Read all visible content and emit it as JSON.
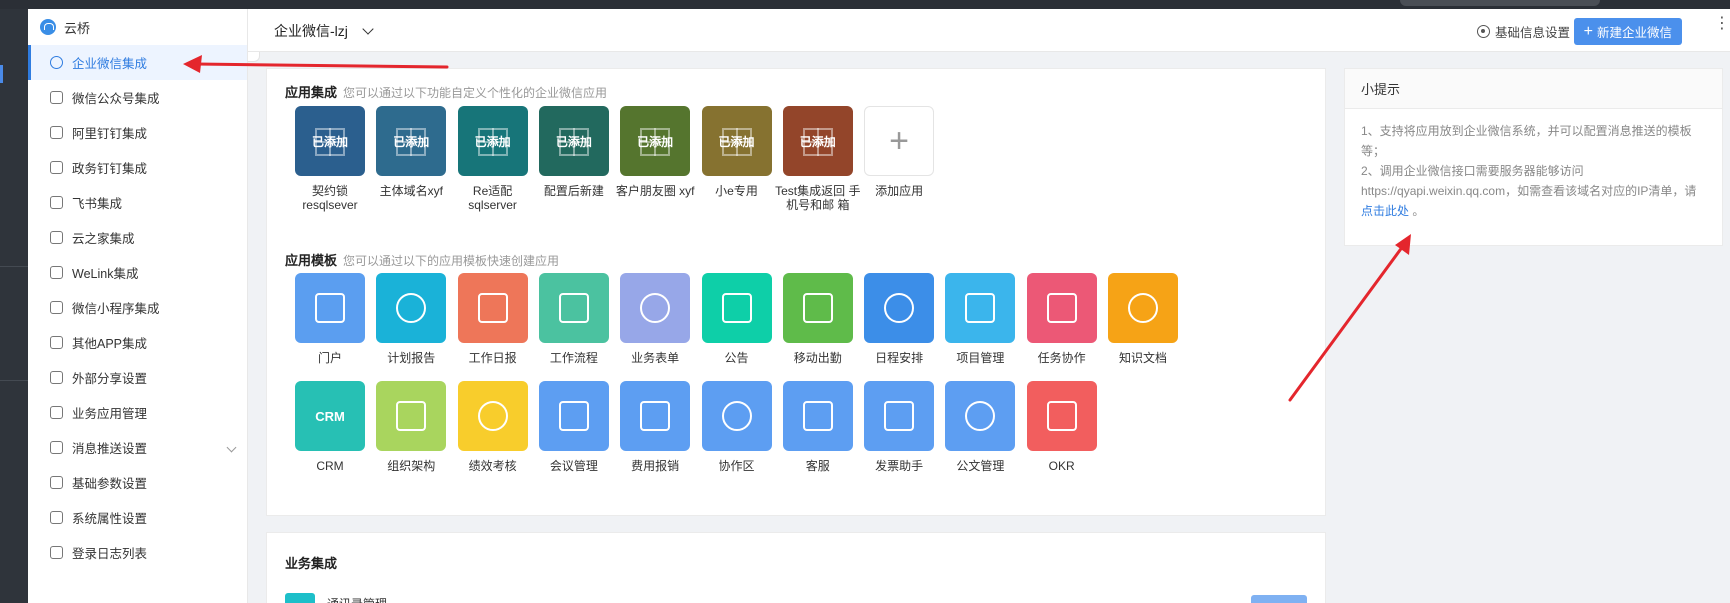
{
  "sidebar": {
    "brand": "云桥",
    "items": [
      {
        "label": "企业微信集成",
        "active": true
      },
      {
        "label": "微信公众号集成"
      },
      {
        "label": "阿里钉钉集成"
      },
      {
        "label": "政务钉钉集成"
      },
      {
        "label": "飞书集成"
      },
      {
        "label": "云之家集成"
      },
      {
        "label": "WeLink集成"
      },
      {
        "label": "微信小程序集成"
      },
      {
        "label": "其他APP集成"
      },
      {
        "label": "外部分享设置"
      },
      {
        "label": "业务应用管理"
      },
      {
        "label": "消息推送设置",
        "has_submenu": true
      },
      {
        "label": "基础参数设置"
      },
      {
        "label": "系统属性设置"
      },
      {
        "label": "登录日志列表"
      }
    ]
  },
  "header": {
    "tenant": "企业微信-lzj",
    "settings_label": "基础信息设置",
    "new_button_label": "新建企业微信",
    "collapse_glyph": "‹",
    "more_glyph": "⋮",
    "new_plus_glyph": "+"
  },
  "integration": {
    "title": "应用集成",
    "subtitle": "您可以通过以下功能自定义个性化的企业微信应用",
    "added_badge": "已添加",
    "add_glyph": "+",
    "apps": [
      {
        "label": "契约锁 resqlsever",
        "color": "#2b5f8e"
      },
      {
        "label": "主体域名xyf",
        "color": "#2e6b8e"
      },
      {
        "label": "Re适配 sqlserver",
        "color": "#177579"
      },
      {
        "label": "配置后新建",
        "color": "#22695e"
      },
      {
        "label": "客户朋友圈 xyf",
        "color": "#55752e"
      },
      {
        "label": "小e专用",
        "color": "#867230"
      },
      {
        "label": "Test集成返回 手机号和邮 箱",
        "color": "#93452a"
      }
    ],
    "add_label": "添加应用"
  },
  "templates": {
    "title": "应用模板",
    "subtitle": "您可以通过以下的应用模板快速创建应用",
    "crm_text": "CRM",
    "items": [
      {
        "label": "门户",
        "color": "#5b9ef0"
      },
      {
        "label": "计划报告",
        "color": "#1ab2d8"
      },
      {
        "label": "工作日报",
        "color": "#ee7659"
      },
      {
        "label": "工作流程",
        "color": "#4bc2a0"
      },
      {
        "label": "业务表单",
        "color": "#97a7e8"
      },
      {
        "label": "公告",
        "color": "#0ecfa8"
      },
      {
        "label": "移动出勤",
        "color": "#5fbb4a"
      },
      {
        "label": "日程安排",
        "color": "#3c8ee8"
      },
      {
        "label": "项目管理",
        "color": "#3bb5ec"
      },
      {
        "label": "任务协作",
        "color": "#ec5876"
      },
      {
        "label": "知识文档",
        "color": "#f6a316"
      },
      {
        "label": "CRM",
        "color": "#27c0b4"
      },
      {
        "label": "组织架构",
        "color": "#a9d55e"
      },
      {
        "label": "绩效考核",
        "color": "#f8cd2c"
      },
      {
        "label": "会议管理",
        "color": "#5d9ef2"
      },
      {
        "label": "费用报销",
        "color": "#5d9ef2"
      },
      {
        "label": "协作区",
        "color": "#5d9ef2"
      },
      {
        "label": "客服",
        "color": "#5d9ef2"
      },
      {
        "label": "发票助手",
        "color": "#5d9ef2"
      },
      {
        "label": "公文管理",
        "color": "#5d9ef2"
      },
      {
        "label": "OKR",
        "color": "#f25e5e"
      }
    ]
  },
  "business": {
    "title": "业务集成",
    "row_label": "通讯录管理"
  },
  "tips": {
    "title": "小提示",
    "line1": "1、支持将应用放到企业微信系统，并可以配置消息推送的模板等；",
    "line2": "2、调用企业微信接口需要服务器能够访问 https://qyapi.weixin.qq.com，如需查看该域名对应的IP清单，请",
    "link": "点击此处",
    "tail": "。"
  },
  "colors": {
    "accent": "#2f7ce0",
    "primary_button": "#4b90ec",
    "annotation_arrow": "#e4262d"
  }
}
